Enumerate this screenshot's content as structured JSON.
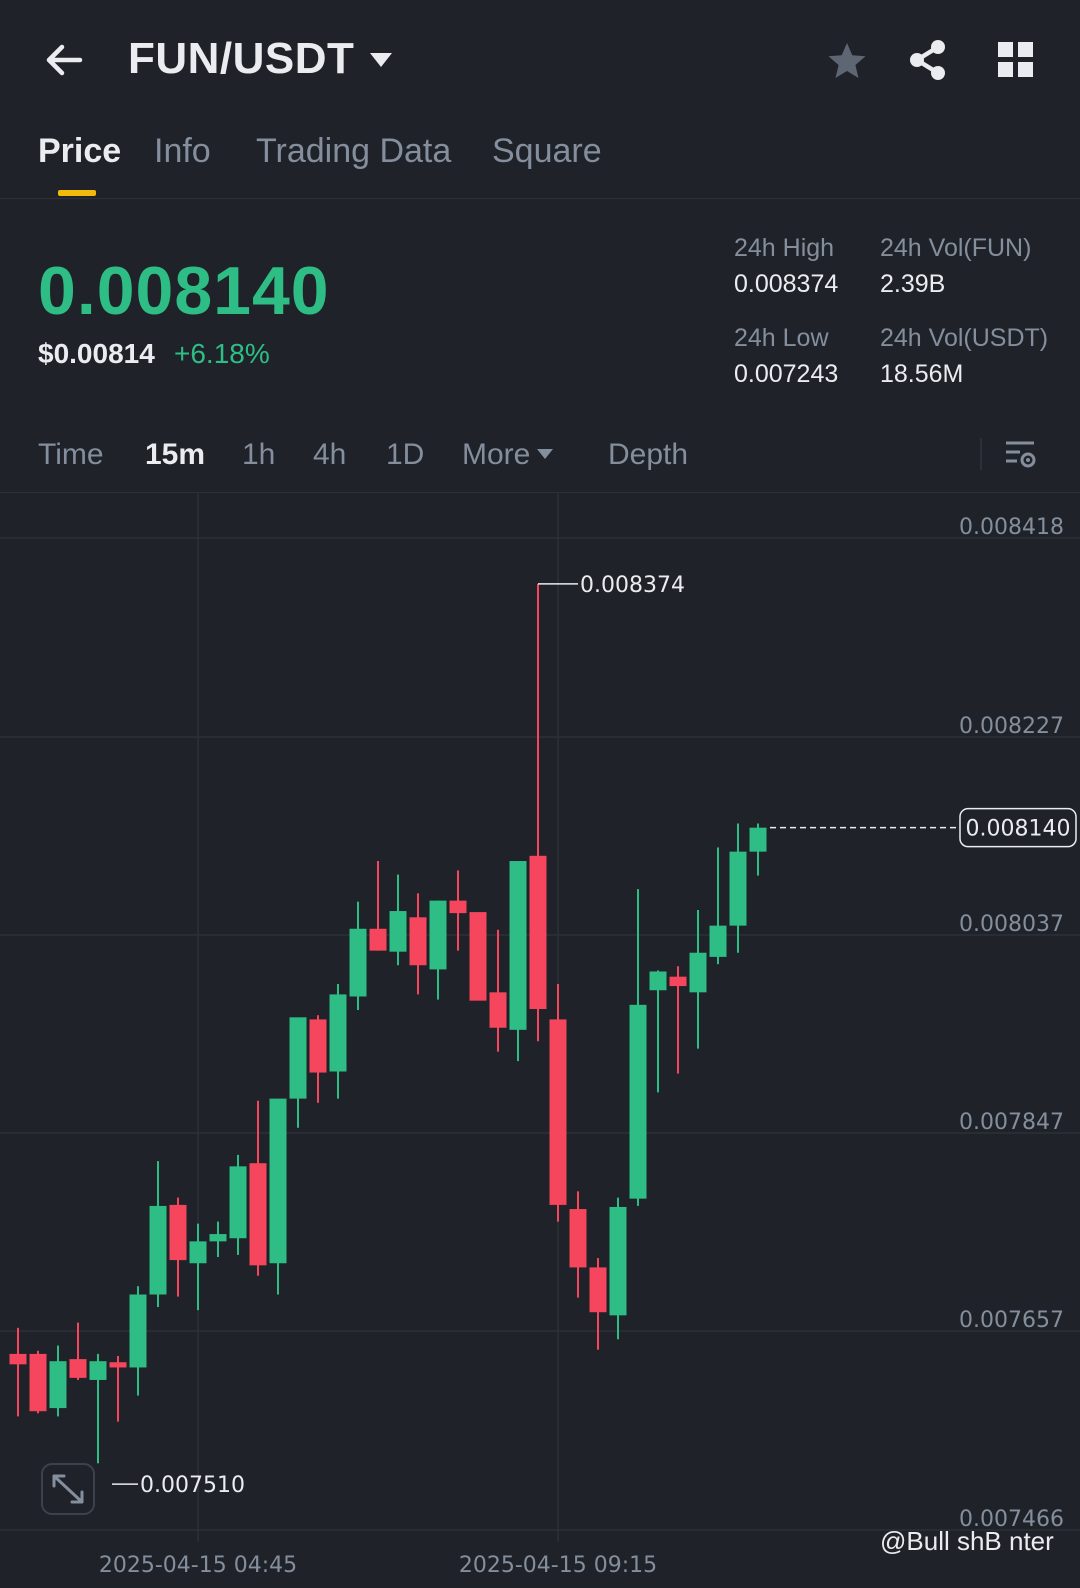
{
  "header": {
    "pair": "FUN/USDT",
    "icons": [
      "back-arrow-icon",
      "caret-down-icon",
      "star-icon",
      "share-icon",
      "grid-icon"
    ]
  },
  "tabs": [
    "Price",
    "Info",
    "Trading Data",
    "Square"
  ],
  "active_tab": "Price",
  "ticker": {
    "last_price": "0.008140",
    "usd_price": "$0.00814",
    "change": "+6.18%",
    "high_label": "24h High",
    "high_value": "0.008374",
    "low_label": "24h Low",
    "low_value": "0.007243",
    "vol_base_label": "24h Vol(FUN)",
    "vol_base_value": "2.39B",
    "vol_quote_label": "24h Vol(USDT)",
    "vol_quote_value": "18.56M"
  },
  "intervals": {
    "time": "Time",
    "m15": "15m",
    "h1": "1h",
    "h4": "4h",
    "d1": "1D",
    "more": "More",
    "depth": "Depth",
    "active": "15m"
  },
  "colors": {
    "up": "#2ebd85",
    "down": "#f6465d",
    "background": "#1f2329",
    "accent": "#f0b90b"
  },
  "watermark": "@Bull shB  nter",
  "chart_data": {
    "type": "candlestick",
    "ylim": [
      0.007466,
      0.008418
    ],
    "y_ticks": [
      "0.008418",
      "0.008227",
      "0.008037",
      "0.007847",
      "0.007657",
      "0.007466"
    ],
    "x_ticks": [
      "2025-04-15 04:45",
      "2025-04-15 09:15"
    ],
    "current_price_label": "0.008140",
    "max_label": "0.008374",
    "min_label": "0.007510",
    "candles": [
      {
        "o": 0.007635,
        "h": 0.00766,
        "l": 0.007575,
        "c": 0.007625
      },
      {
        "o": 0.007635,
        "h": 0.007638,
        "l": 0.007578,
        "c": 0.00758
      },
      {
        "o": 0.007583,
        "h": 0.007643,
        "l": 0.007575,
        "c": 0.007628
      },
      {
        "o": 0.00763,
        "h": 0.007665,
        "l": 0.00761,
        "c": 0.007612
      },
      {
        "o": 0.00761,
        "h": 0.007635,
        "l": 0.00753,
        "c": 0.007628
      },
      {
        "o": 0.007627,
        "h": 0.007633,
        "l": 0.00757,
        "c": 0.007622
      },
      {
        "o": 0.007622,
        "h": 0.0077,
        "l": 0.007595,
        "c": 0.007692
      },
      {
        "o": 0.007692,
        "h": 0.00782,
        "l": 0.00768,
        "c": 0.007777
      },
      {
        "o": 0.007778,
        "h": 0.007785,
        "l": 0.00769,
        "c": 0.007725
      },
      {
        "o": 0.007722,
        "h": 0.00776,
        "l": 0.007677,
        "c": 0.007743
      },
      {
        "o": 0.007743,
        "h": 0.007762,
        "l": 0.007728,
        "c": 0.00775
      },
      {
        "o": 0.007746,
        "h": 0.007826,
        "l": 0.00773,
        "c": 0.007815
      },
      {
        "o": 0.007818,
        "h": 0.007878,
        "l": 0.00771,
        "c": 0.00772
      },
      {
        "o": 0.007722,
        "h": 0.007855,
        "l": 0.007692,
        "c": 0.00788
      },
      {
        "o": 0.00788,
        "h": 0.007945,
        "l": 0.007852,
        "c": 0.007958
      },
      {
        "o": 0.007956,
        "h": 0.00796,
        "l": 0.007876,
        "c": 0.007905
      },
      {
        "o": 0.007906,
        "h": 0.00799,
        "l": 0.00788,
        "c": 0.00798
      },
      {
        "o": 0.007978,
        "h": 0.008069,
        "l": 0.007965,
        "c": 0.008043
      },
      {
        "o": 0.008043,
        "h": 0.008108,
        "l": 0.008022,
        "c": 0.008022
      },
      {
        "o": 0.008021,
        "h": 0.008095,
        "l": 0.008008,
        "c": 0.00806
      },
      {
        "o": 0.008054,
        "h": 0.008077,
        "l": 0.00798,
        "c": 0.008008
      },
      {
        "o": 0.008004,
        "h": 0.00807,
        "l": 0.007975,
        "c": 0.00807
      },
      {
        "o": 0.00807,
        "h": 0.008099,
        "l": 0.008022,
        "c": 0.008058
      },
      {
        "o": 0.008059,
        "h": 0.008057,
        "l": 0.007988,
        "c": 0.007974
      },
      {
        "o": 0.007982,
        "h": 0.008042,
        "l": 0.007925,
        "c": 0.007948
      },
      {
        "o": 0.007946,
        "h": 0.008108,
        "l": 0.007916,
        "c": 0.008108
      },
      {
        "o": 0.008113,
        "h": 0.008374,
        "l": 0.007935,
        "c": 0.007966
      },
      {
        "o": 0.007956,
        "h": 0.00799,
        "l": 0.007762,
        "c": 0.007778
      },
      {
        "o": 0.007774,
        "h": 0.007791,
        "l": 0.007689,
        "c": 0.007718
      },
      {
        "o": 0.007718,
        "h": 0.007727,
        "l": 0.007639,
        "c": 0.007675
      },
      {
        "o": 0.007672,
        "h": 0.007785,
        "l": 0.007649,
        "c": 0.007776
      },
      {
        "o": 0.007784,
        "h": 0.008081,
        "l": 0.007777,
        "c": 0.00797
      },
      {
        "o": 0.007984,
        "h": 0.008003,
        "l": 0.007886,
        "c": 0.008002
      },
      {
        "o": 0.007997,
        "h": 0.008007,
        "l": 0.007904,
        "c": 0.007988
      },
      {
        "o": 0.007982,
        "h": 0.008061,
        "l": 0.007928,
        "c": 0.00802
      },
      {
        "o": 0.008016,
        "h": 0.008121,
        "l": 0.008009,
        "c": 0.008046
      },
      {
        "o": 0.008046,
        "h": 0.008144,
        "l": 0.00802,
        "c": 0.008117
      },
      {
        "o": 0.008117,
        "h": 0.008144,
        "l": 0.008094,
        "c": 0.00814
      }
    ]
  }
}
